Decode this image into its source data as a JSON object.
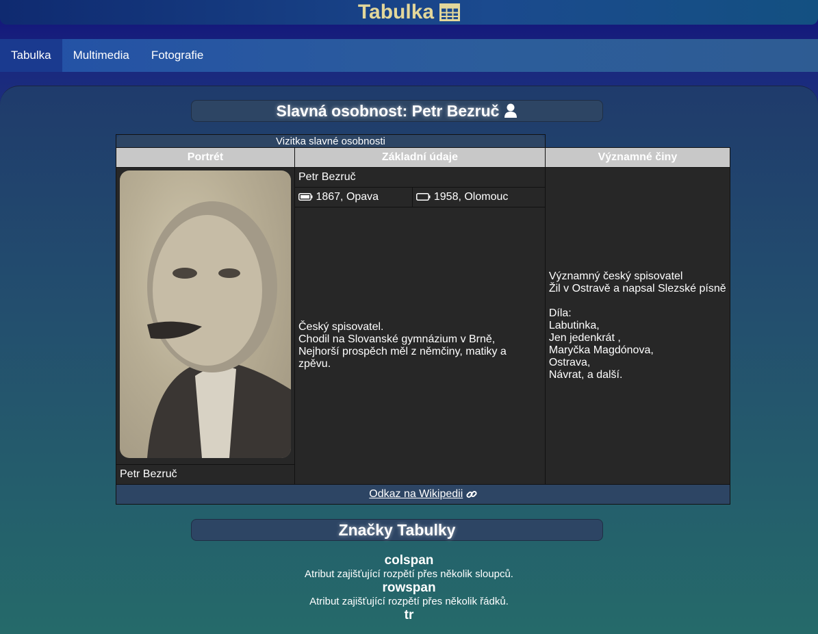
{
  "site": {
    "title": "Tabulka",
    "title_icon": "table-icon"
  },
  "nav": {
    "items": [
      {
        "label": "Tabulka",
        "active": true
      },
      {
        "label": "Multimedia",
        "active": false
      },
      {
        "label": "Fotografie",
        "active": false
      }
    ]
  },
  "person_heading": {
    "text": "Slavná osobnost: Petr Bezruč",
    "icon": "user-icon"
  },
  "card": {
    "caption": "Vizitka slavné osobnosti",
    "headers": {
      "portrait": "Portrét",
      "basic": "Základní údaje",
      "deeds": "Významné činy"
    },
    "name": "Petr Bezruč",
    "born": "1867, Opava",
    "died": "1958, Olomouc",
    "bio": [
      "Český spisovatel.",
      "Chodil na Slovanské gymnázium v Brně,",
      "Nejhorší prospěch měl z němčiny, matiky a zpěvu."
    ],
    "deeds": [
      "Významný český spisovatel",
      "Žil v Ostravě a napsal Slezské písně",
      "",
      "Díla:",
      "Labutinka,",
      "Jen jedenkrát ,",
      "Maryčka Magdónova,",
      "Ostrava,",
      "Návrat, a další."
    ],
    "portrait_caption": "Petr Bezruč",
    "wiki_link": "Odkaz na Wikipedii"
  },
  "tags_heading": "Značky Tabulky",
  "tags": [
    {
      "name": "colspan",
      "desc": "Atribut zajišťující rozpětí přes několik sloupců."
    },
    {
      "name": "rowspan",
      "desc": "Atribut zajišťující rozpětí přes několik řádků."
    },
    {
      "name": "tr",
      "desc": ""
    }
  ]
}
